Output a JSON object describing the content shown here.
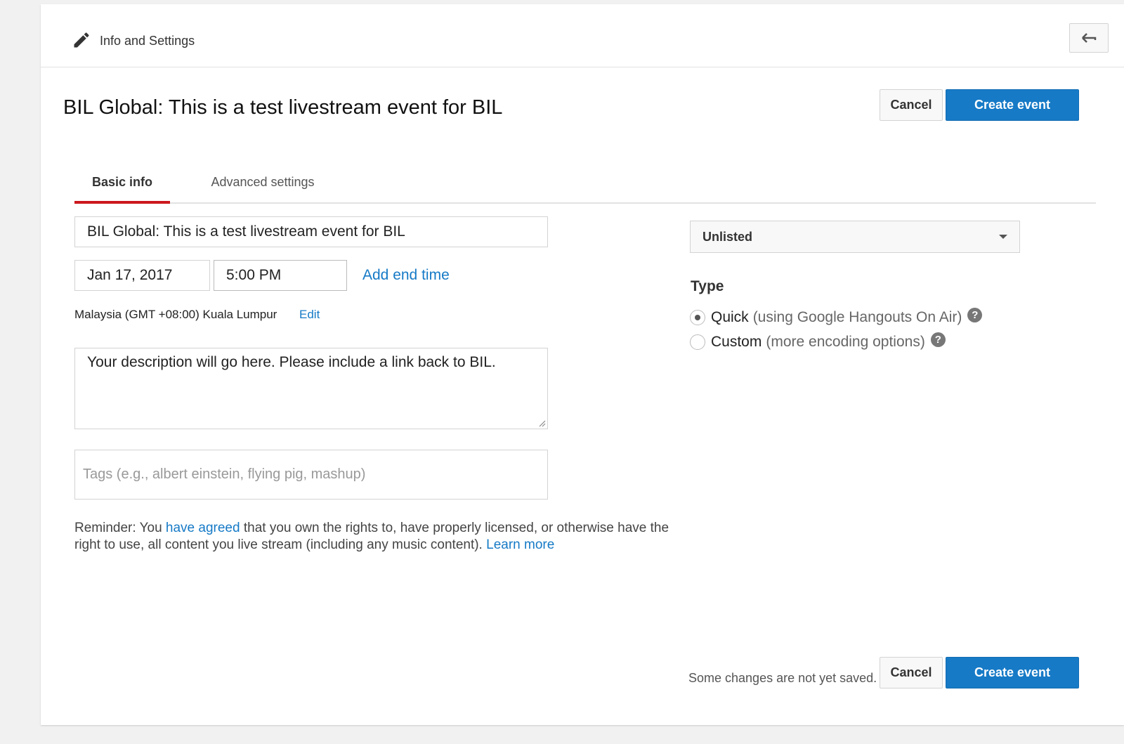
{
  "header": {
    "title": "Info and Settings"
  },
  "event": {
    "title": "BIL Global: This is a test livestream event for BIL"
  },
  "actions": {
    "cancel_label": "Cancel",
    "create_label": "Create event"
  },
  "tabs": [
    {
      "label": "Basic info",
      "active": true
    },
    {
      "label": "Advanced settings",
      "active": false
    }
  ],
  "form": {
    "title_value": "BIL Global: This is a test livestream event for BIL",
    "date_value": "Jan 17, 2017",
    "time_value": "5:00 PM",
    "add_end_time_label": "Add end time",
    "timezone": "Malaysia (GMT +08:00) Kuala Lumpur",
    "timezone_edit_label": "Edit",
    "description_value": "Your description will go here. Please include a link back to BIL.",
    "tags_placeholder": "Tags (e.g., albert einstein, flying pig, mashup)"
  },
  "reminder": {
    "prefix": "Reminder: You ",
    "agreed_link": "have agreed",
    "middle": " that you own the rights to, have properly licensed, or otherwise have the right to use, all content you live stream (including any music content). ",
    "learn_more_link": "Learn more"
  },
  "privacy": {
    "selected": "Unlisted"
  },
  "type": {
    "label": "Type",
    "options": [
      {
        "label": "Quick",
        "detail": "(using Google Hangouts On Air)",
        "selected": true
      },
      {
        "label": "Custom",
        "detail": "(more encoding options)",
        "selected": false
      }
    ]
  },
  "footer": {
    "status": "Some changes are not yet saved."
  },
  "colors": {
    "accent": "#167ac6",
    "tab_indicator": "#cc181e"
  },
  "icons": {
    "edit": "pencil-icon",
    "back": "back-arrow-icon",
    "help": "help-icon",
    "dropdown": "chevron-down-icon"
  }
}
